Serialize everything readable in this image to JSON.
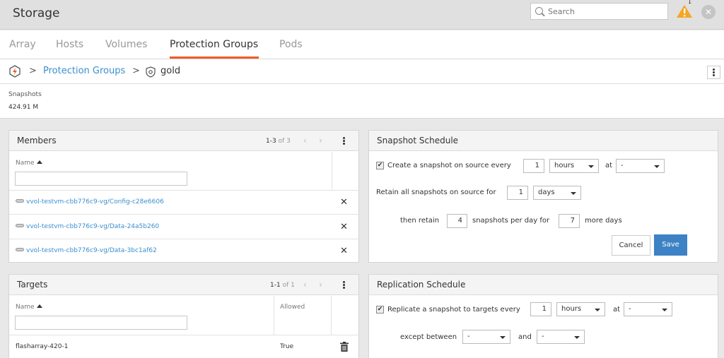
{
  "header": {
    "title": "Storage",
    "search_placeholder": "Search",
    "alert_count": "1",
    "close_symbol": "✕",
    "warning_color": "#f5a623"
  },
  "tabs": [
    {
      "label": "Array"
    },
    {
      "label": "Hosts"
    },
    {
      "label": "Volumes"
    },
    {
      "label": "Protection Groups",
      "active": true
    },
    {
      "label": "Pods"
    }
  ],
  "breadcrumb": {
    "separator": ">",
    "link": "Protection Groups",
    "current": "gold"
  },
  "stats": {
    "label": "Snapshots",
    "value": "424.91 M"
  },
  "members": {
    "title": "Members",
    "pager_range": "1-3",
    "pager_of": "of 3",
    "column_name": "Name",
    "rows": [
      {
        "name": "vvol-testvm-cbb776c9-vg/Config-c28e6606"
      },
      {
        "name": "vvol-testvm-cbb776c9-vg/Data-24a5b260"
      },
      {
        "name": "vvol-testvm-cbb776c9-vg/Data-3bc1af62"
      }
    ],
    "remove_symbol": "✕"
  },
  "targets": {
    "title": "Targets",
    "pager_range": "1-1",
    "pager_of": "of 1",
    "column_name": "Name",
    "column_allowed": "Allowed",
    "rows": [
      {
        "name": "flasharray-420-1",
        "allowed": "True"
      }
    ]
  },
  "snapshot_schedule": {
    "title": "Snapshot Schedule",
    "create_label": "Create a snapshot on source every",
    "create_checked": true,
    "create_every": "1",
    "create_unit": "hours",
    "at_label": "at",
    "at_value": "-",
    "retain_label": "Retain all snapshots on source for",
    "retain_for": "1",
    "retain_unit": "days",
    "then_retain_label": "then retain",
    "then_retain_count": "4",
    "per_day_label": "snapshots per day for",
    "more_days_count": "7",
    "more_days_label": "more days",
    "cancel_label": "Cancel",
    "save_label": "Save",
    "accent_color": "#3d82c4"
  },
  "replication_schedule": {
    "title": "Replication Schedule",
    "replicate_label": "Replicate a snapshot to targets every",
    "replicate_checked": true,
    "replicate_every": "1",
    "replicate_unit": "hours",
    "at_label": "at",
    "at_value": "-",
    "except_label": "except between",
    "except_from": "-",
    "and_label": "and",
    "except_to": "-"
  }
}
